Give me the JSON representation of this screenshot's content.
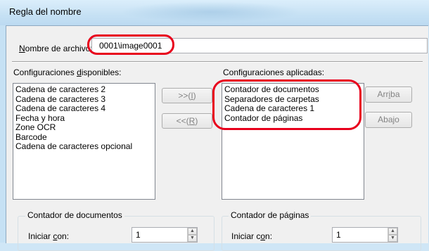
{
  "window": {
    "title": "Regla del nombre"
  },
  "filename": {
    "label_mnemonic": "N",
    "label_rest": "ombre de archivo:",
    "value": "0001\\image0001"
  },
  "available": {
    "label_prefix": "Configuraciones ",
    "label_mnemonic": "d",
    "label_suffix": "isponibles:",
    "items": [
      "Cadena de caracteres 2",
      "Cadena de caracteres 3",
      "Cadena de caracteres 4",
      "Fecha y hora",
      "Zone OCR",
      "Barcode",
      "Cadena de caracteres opcional"
    ]
  },
  "applied": {
    "label": "Configuraciones aplicadas:",
    "items": [
      "Contador de documentos",
      "Separadores de carpetas",
      "Cadena de caracteres 1",
      "Contador de páginas"
    ]
  },
  "buttons": {
    "add_prefix": ">>(",
    "add_mnemonic": "I",
    "add_suffix": ")",
    "remove_prefix": "<<(",
    "remove_mnemonic": "R",
    "remove_suffix": ")",
    "up_prefix": "Arr",
    "up_mnemonic": "i",
    "up_suffix": "ba",
    "down": "Abajo"
  },
  "doc_counter": {
    "title": "Contador de documentos",
    "start_prefix": "Iniciar ",
    "start_mnemonic": "c",
    "start_suffix": "on:",
    "start_value": "1"
  },
  "page_counter": {
    "title": "Contador de páginas",
    "start_prefix": "Iniciar c",
    "start_mnemonic": "o",
    "start_suffix": "n:",
    "start_value": "1"
  },
  "colors": {
    "highlight": "#e8001c",
    "titlebar": "#c6e1f4",
    "dialog": "#f0f0f0"
  }
}
